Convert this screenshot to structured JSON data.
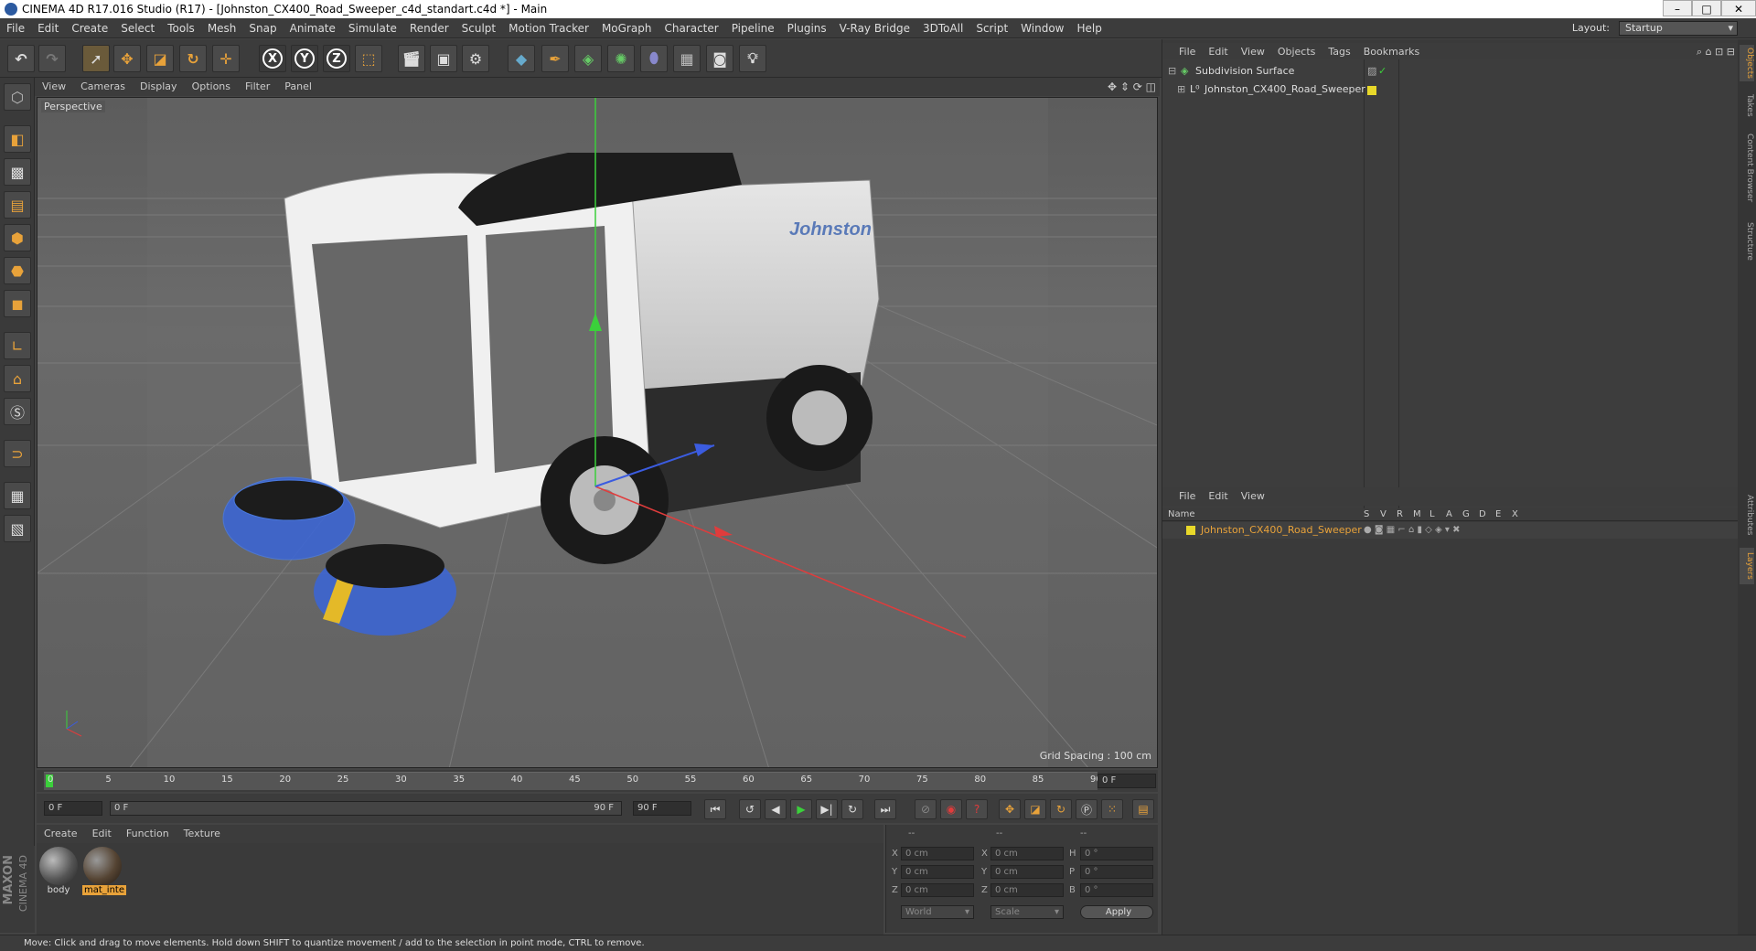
{
  "window": {
    "title": "CINEMA 4D R17.016 Studio (R17) - [Johnston_CX400_Road_Sweeper_c4d_standart.c4d *] - Main"
  },
  "menubar": {
    "items": [
      "File",
      "Edit",
      "Create",
      "Select",
      "Tools",
      "Mesh",
      "Snap",
      "Animate",
      "Simulate",
      "Render",
      "Sculpt",
      "Motion Tracker",
      "MoGraph",
      "Character",
      "Pipeline",
      "Plugins",
      "V-Ray Bridge",
      "3DToAll",
      "Script",
      "Window",
      "Help"
    ],
    "layout_label": "Layout:",
    "layout_value": "Startup"
  },
  "viewport": {
    "menu": [
      "View",
      "Cameras",
      "Display",
      "Options",
      "Filter",
      "Panel"
    ],
    "camera_label": "Perspective",
    "grid_spacing": "Grid Spacing : 100 cm",
    "truck_logo": "Johnston"
  },
  "timeline": {
    "ticks": [
      "0",
      "5",
      "10",
      "15",
      "20",
      "25",
      "30",
      "35",
      "40",
      "45",
      "50",
      "55",
      "60",
      "65",
      "70",
      "75",
      "80",
      "85",
      "90"
    ],
    "current_frame": "0 F",
    "start_frame": "0 F",
    "range_start": "0 F",
    "range_end": "90 F",
    "end_frame": "90 F"
  },
  "materials": {
    "menu": [
      "Create",
      "Edit",
      "Function",
      "Texture"
    ],
    "items": [
      {
        "name": "body"
      },
      {
        "name": "mat_inte"
      }
    ]
  },
  "coords": {
    "header": [
      "--",
      "--",
      "--"
    ],
    "rows": [
      {
        "a": "X",
        "av": "0 cm",
        "b": "X",
        "bv": "0 cm",
        "c": "H",
        "cv": "0 °"
      },
      {
        "a": "Y",
        "av": "0 cm",
        "b": "Y",
        "bv": "0 cm",
        "c": "P",
        "cv": "0 °"
      },
      {
        "a": "Z",
        "av": "0 cm",
        "b": "Z",
        "bv": "0 cm",
        "c": "B",
        "cv": "0 °"
      }
    ],
    "world": "World",
    "scale": "Scale",
    "apply": "Apply"
  },
  "objects": {
    "menu": [
      "File",
      "Edit",
      "View",
      "Objects",
      "Tags",
      "Bookmarks"
    ],
    "tree": [
      {
        "name": "Subdivision Surface",
        "color": "#ddd"
      },
      {
        "name": "Johnston_CX400_Road_Sweeper",
        "color": "#ddd"
      }
    ]
  },
  "layers": {
    "menu": [
      "File",
      "Edit",
      "View"
    ],
    "columns": [
      "Name",
      "S",
      "V",
      "R",
      "M",
      "L",
      "A",
      "G",
      "D",
      "E",
      "X"
    ],
    "rows": [
      {
        "name": "Johnston_CX400_Road_Sweeper",
        "color": "#e8a23a"
      }
    ]
  },
  "sidetabs": [
    "Objects",
    "Takes",
    "Content Browser",
    "Structure",
    "Attributes",
    "Layers"
  ],
  "status": "Move: Click and drag to move elements. Hold down SHIFT to quantize movement / add to the selection in point mode, CTRL to remove.",
  "branding": {
    "line1": "MAXON",
    "line2": "CINEMA 4D"
  },
  "colors": {
    "accent": "#e8a23a",
    "bg": "#3c3c3c"
  }
}
